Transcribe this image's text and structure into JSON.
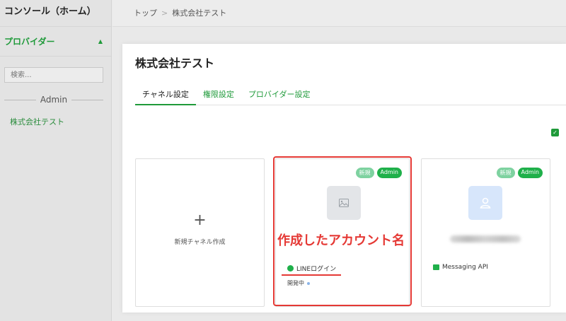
{
  "sidebar": {
    "console_label": "コンソール（ホーム）",
    "provider_label": "プロバイダー",
    "search_placeholder": "検索...",
    "group_label": "Admin",
    "items": [
      {
        "label": "株式会社テスト"
      }
    ]
  },
  "breadcrumb": {
    "items": [
      "トップ",
      "株式会社テスト"
    ],
    "separator": ">"
  },
  "modal": {
    "title": "株式会社テスト",
    "tabs": [
      {
        "label": "チャネル設定",
        "active": true
      },
      {
        "label": "権限設定",
        "active": false
      },
      {
        "label": "プロバイダー設定",
        "active": false
      }
    ]
  },
  "cards": {
    "new_channel": {
      "plus": "+",
      "label": "新規チャネル作成"
    },
    "line_login": {
      "badge_new": "新規",
      "badge_admin": "Admin",
      "type": "LINEログイン",
      "status": "開発中"
    },
    "messaging": {
      "badge_new": "新規",
      "badge_admin": "Admin",
      "type": "Messaging API"
    }
  },
  "annotation": {
    "text": "作成したアカウント名",
    "color": "#e53935"
  },
  "colors": {
    "accent": "#1f9a3a",
    "badge_admin": "#1fb04a",
    "badge_new": "#7ed2a0"
  }
}
